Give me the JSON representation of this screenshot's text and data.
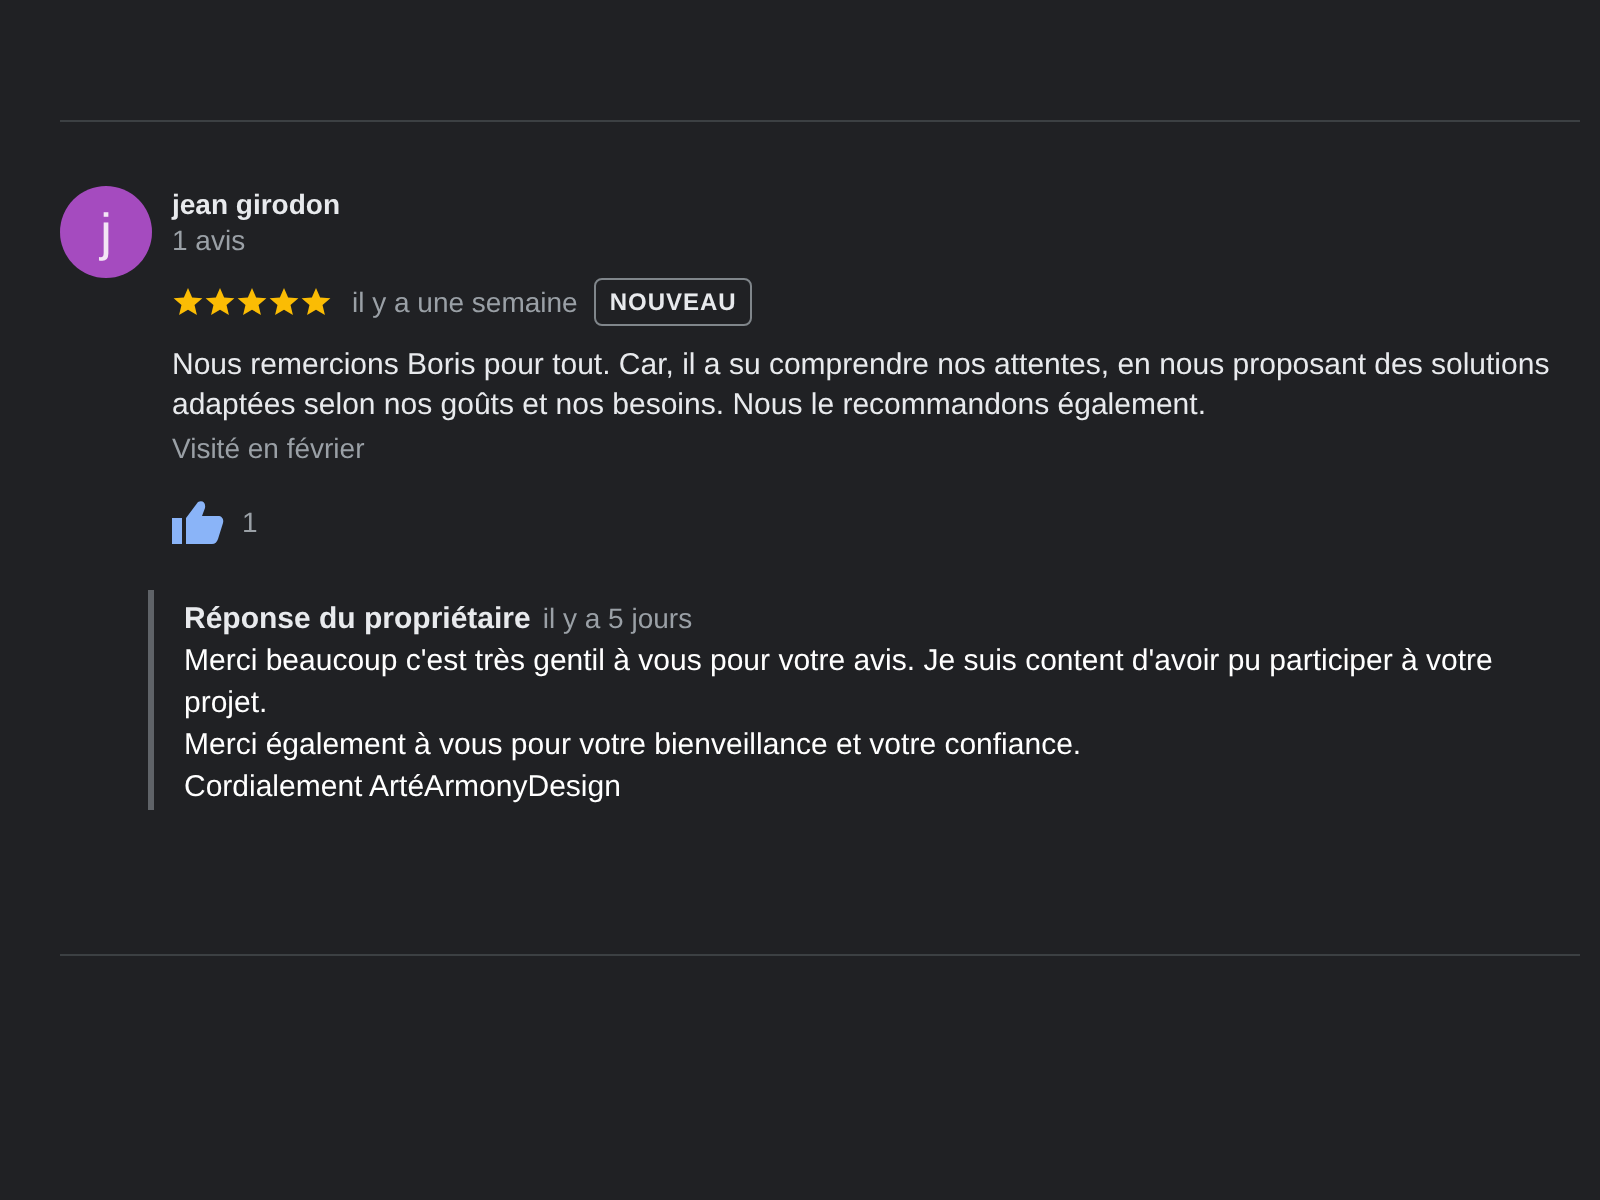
{
  "review": {
    "author": {
      "initial": "j",
      "name": "jean girodon",
      "count": "1 avis",
      "color": "#a54bbf"
    },
    "stars": 5,
    "time": "il y a une semaine",
    "badge": "NOUVEAU",
    "text": "Nous remercions Boris pour tout. Car, il a su comprendre nos attentes, en nous proposant des solutions adaptées selon nos goûts et nos besoins. Nous le recommandons également.",
    "visited": "Visité en février",
    "likes": "1"
  },
  "owner_reply": {
    "title": "Réponse du propriétaire",
    "time": "il y a 5 jours",
    "lines": [
      "Merci beaucoup c'est très gentil à vous pour votre avis. Je suis content d'avoir pu participer à votre projet.",
      "Merci également à vous pour votre bienveillance et votre confiance.",
      "Cordialement ArtéArmonyDesign"
    ]
  }
}
